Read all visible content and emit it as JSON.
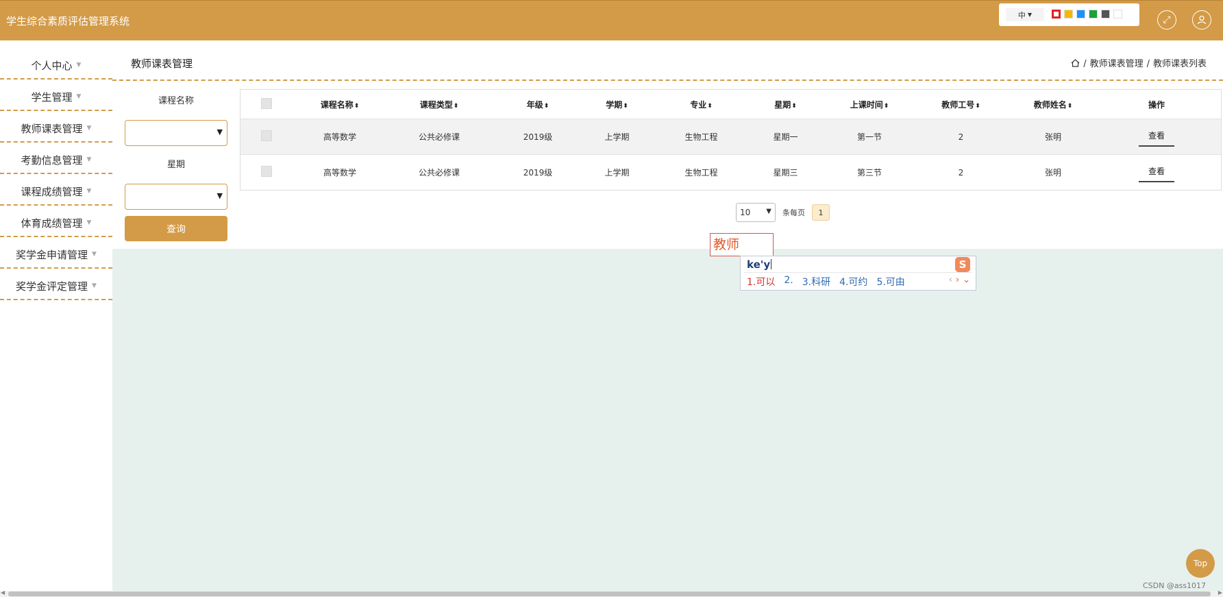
{
  "app": {
    "title": "学生综合素质评估管理系统"
  },
  "header": {
    "lang": "中",
    "theme_colors": [
      "#e02020",
      "#f5b800",
      "#1e90ff",
      "#1aa33a",
      "#555555",
      "#ffffff"
    ],
    "fullscreen_icon": "expand-icon",
    "user_icon": "user-icon"
  },
  "sidebar": {
    "items": [
      {
        "label": "个人中心"
      },
      {
        "label": "学生管理"
      },
      {
        "label": "教师课表管理"
      },
      {
        "label": "考勤信息管理"
      },
      {
        "label": "课程成绩管理"
      },
      {
        "label": "体育成绩管理"
      },
      {
        "label": "奖学金申请管理"
      },
      {
        "label": "奖学金评定管理"
      }
    ]
  },
  "page": {
    "title": "教师课表管理",
    "breadcrumb": [
      "教师课表管理",
      "教师课表列表"
    ]
  },
  "filter": {
    "course_label": "课程名称",
    "week_label": "星期",
    "query_label": "查询"
  },
  "table": {
    "columns": [
      "课程名称",
      "课程类型",
      "年级",
      "学期",
      "专业",
      "星期",
      "上课时间",
      "教师工号",
      "教师姓名",
      "操作"
    ],
    "rows": [
      {
        "course": "高等数学",
        "type": "公共必修课",
        "grade": "2019级",
        "term": "上学期",
        "major": "生物工程",
        "weekday": "星期一",
        "time": "第一节",
        "teacher_no": "2",
        "teacher_name": "张明",
        "action": "查看"
      },
      {
        "course": "高等数学",
        "type": "公共必修课",
        "grade": "2019级",
        "term": "上学期",
        "major": "生物工程",
        "weekday": "星期三",
        "time": "第三节",
        "teacher_no": "2",
        "teacher_name": "张明",
        "action": "查看"
      }
    ]
  },
  "pagination": {
    "page_size": "10",
    "per_page_label": "条每页",
    "current_page": "1"
  },
  "ime": {
    "composition": "教师",
    "input": "ke'y",
    "logo": "S",
    "candidates": [
      "1.可以",
      "2.",
      "3.科研",
      "4.可约",
      "5.可由"
    ]
  },
  "back_to_top": "Top",
  "watermark": "CSDN @ass1017"
}
